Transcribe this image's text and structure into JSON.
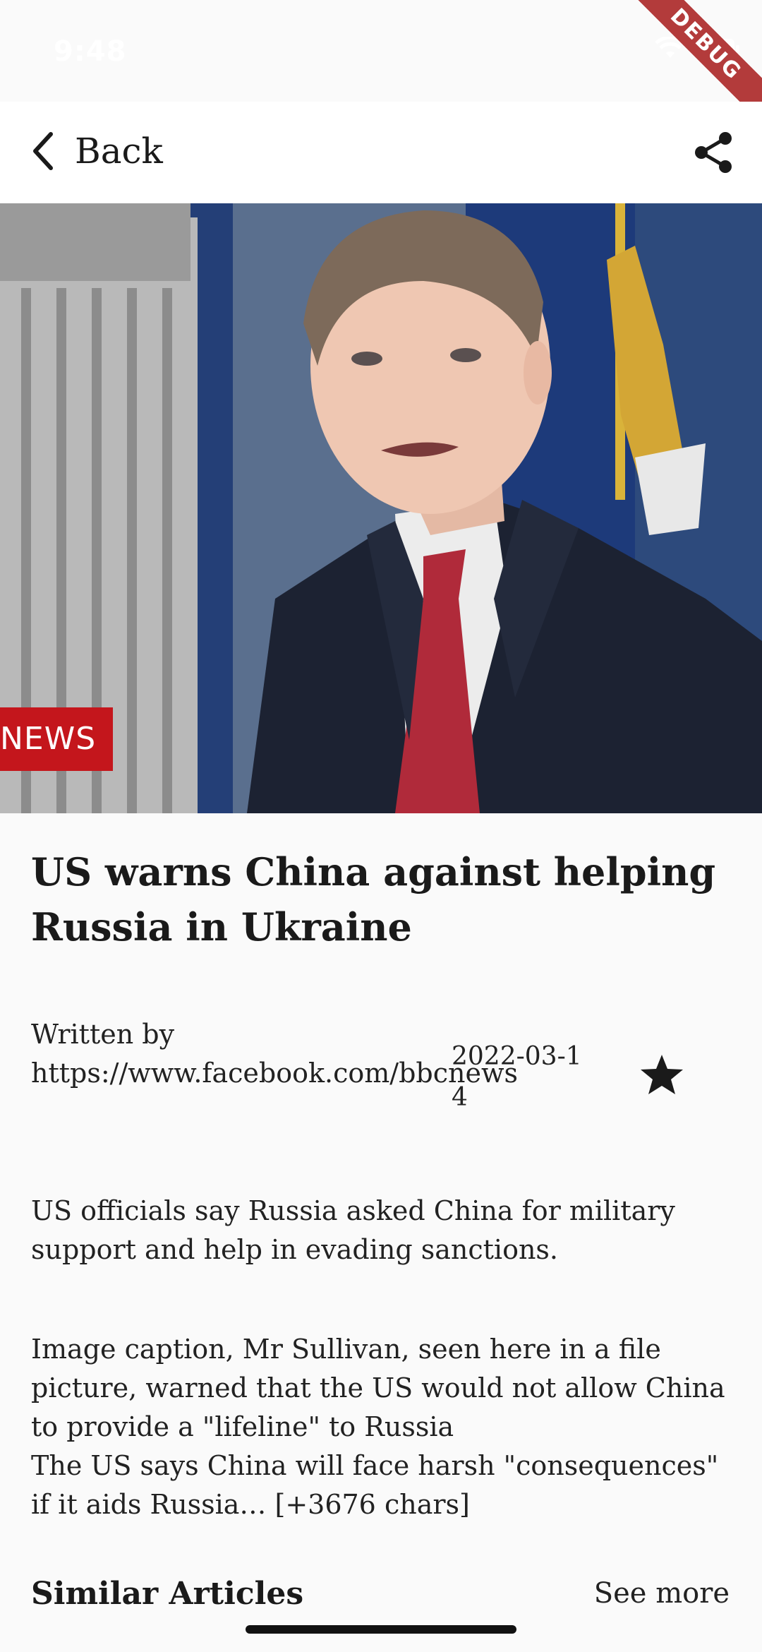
{
  "status_bar": {
    "time": "9:48",
    "debug_label": "DEBUG"
  },
  "app_bar": {
    "back_label": "Back",
    "back_icon": "chevron-left-icon",
    "share_icon": "share-icon"
  },
  "hero": {
    "badge_text": "NEWS",
    "colors": {
      "badge": "#c4161c",
      "suit": "#1c2232",
      "tie": "#b02a3a",
      "backdrop": "#1f3c78"
    }
  },
  "article": {
    "title": "US warns China against helping Russia in Ukraine",
    "author": "Written by https://www.facebook.com/bbcnews",
    "date": "2022-03-14",
    "favorite_icon": "star-icon",
    "description": "US officials say Russia asked China for military support and help in evading sanctions.",
    "content": "Image caption, Mr Sullivan, seen here in a file picture, warned that the US would not allow China to provide a \"lifeline\" to Russia\nThe US says China will face harsh \"consequences\" if it aids Russia… [+3676 chars]"
  },
  "similar": {
    "title": "Similar Articles",
    "see_more": "See more"
  }
}
